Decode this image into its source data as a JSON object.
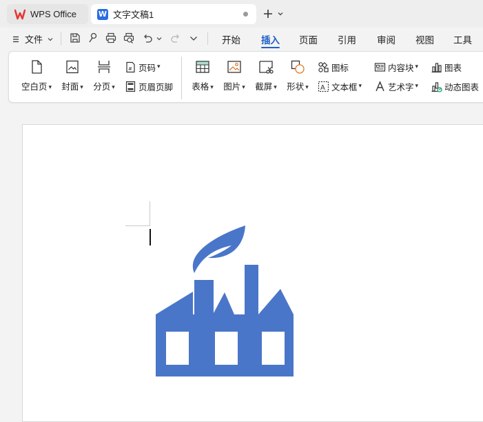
{
  "tabs": {
    "home_tab_label": "WPS Office",
    "doc_tab_label": "文字文稿1",
    "new_tab_icon": "plus-icon"
  },
  "menu": {
    "file_label": "文件",
    "items": [
      "开始",
      "插入",
      "页面",
      "引用",
      "审阅",
      "视图",
      "工具"
    ],
    "active": "插入"
  },
  "quick_access": [
    "save-icon",
    "format-painter-icon",
    "print-icon",
    "print-preview-icon",
    "undo-icon",
    "redo-icon",
    "more-icon"
  ],
  "ribbon": {
    "blank_page": "空白页",
    "cover": "封面",
    "page_break": "分页",
    "page_number": "页码",
    "header_footer": "页眉页脚",
    "table": "表格",
    "picture": "图片",
    "screenshot": "截屏",
    "shape": "形状",
    "icon": "图标",
    "text_box": "文本框",
    "content_block": "内容块",
    "word_art": "艺术字",
    "chart": "图表",
    "dynamic_chart": "动态图表"
  },
  "document": {
    "image_icon": "factory-leaf-icon",
    "image_color": "#4a76c9"
  },
  "colors": {
    "accent": "#1f5fc7",
    "wps_red": "#e53935",
    "doc_blue": "#2b6de0"
  }
}
